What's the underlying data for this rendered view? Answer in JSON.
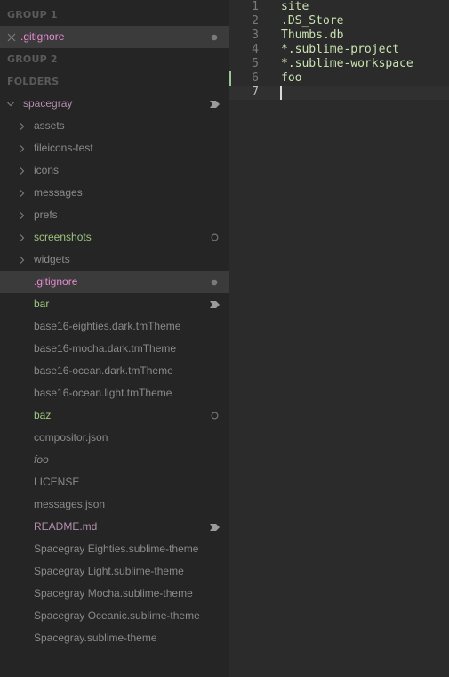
{
  "sidebar": {
    "group1_title": "GROUP 1",
    "group2_title": "GROUP 2",
    "folders_title": "FOLDERS",
    "open_file": ".gitignore",
    "root_folder": "spacegray",
    "folders": [
      "assets",
      "fileicons-test",
      "icons",
      "messages",
      "prefs",
      "screenshots",
      "widgets"
    ],
    "files": [
      ".gitignore",
      "bar",
      "base16-eighties.dark.tmTheme",
      "base16-mocha.dark.tmTheme",
      "base16-ocean.dark.tmTheme",
      "base16-ocean.light.tmTheme",
      "baz",
      "compositor.json",
      "foo",
      "LICENSE",
      "messages.json",
      "README.md",
      "Spacegray Eighties.sublime-theme",
      "Spacegray Light.sublime-theme",
      "Spacegray Mocha.sublime-theme",
      "Spacegray Oceanic.sublime-theme",
      "Spacegray.sublime-theme"
    ]
  },
  "editor": {
    "line_numbers": [
      "1",
      "2",
      "3",
      "4",
      "5",
      "6",
      "7"
    ],
    "lines": [
      "site",
      ".DS_Store",
      "Thumbs.db",
      "*.sublime-project",
      "*.sublime-workspace",
      "foo",
      ""
    ]
  },
  "colors": {
    "modified": "#e58bd0",
    "untracked": "#9ec47d",
    "staged": "#b48ead",
    "diff_added": "#99c794"
  }
}
